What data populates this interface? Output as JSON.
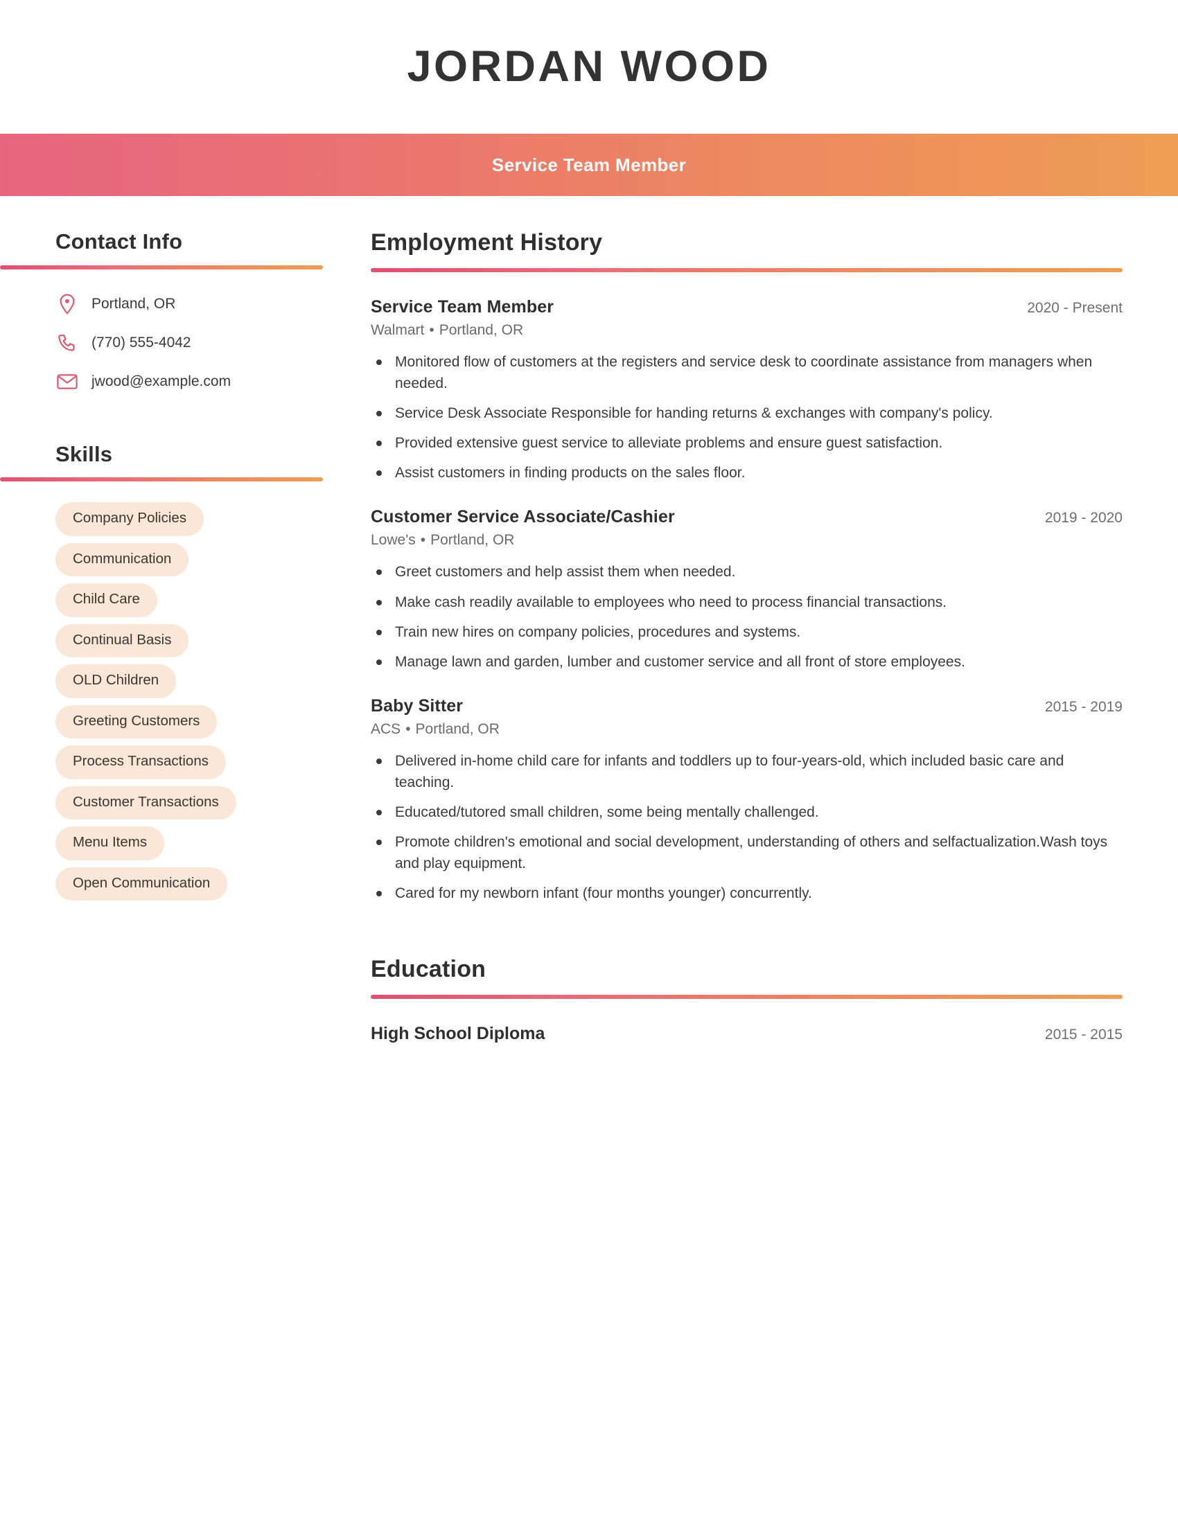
{
  "header": {
    "full_name": "JORDAN WOOD",
    "job_title": "Service Team Member",
    "accent_pink": "#e8657f",
    "accent_orange": "#ef9d54",
    "band_text_color": "#ffffff"
  },
  "sidebar": {
    "contact": {
      "heading": "Contact Info",
      "items": [
        {
          "icon": "location-pin-icon",
          "value": "Portland, OR"
        },
        {
          "icon": "phone-icon",
          "value": "(770) 555-4042"
        },
        {
          "icon": "envelope-icon",
          "value": "jwood@example.com"
        }
      ]
    },
    "skills": {
      "heading": "Skills",
      "chip_bg": "#fae7d7",
      "items": [
        "Company Policies",
        "Communication",
        "Child Care",
        "Continual Basis",
        "OLD Children",
        "Greeting Customers",
        "Process Transactions",
        "Customer Transactions",
        "Menu Items",
        "Open Communication"
      ]
    }
  },
  "main": {
    "employment": {
      "heading": "Employment History",
      "entries": [
        {
          "role": "Service Team Member",
          "dates": "2020 - Present",
          "company": "Walmart",
          "separator": "•",
          "location": "Portland, OR",
          "bullets": [
            "Monitored flow of customers at the registers and service desk to coordinate assistance from managers when needed.",
            "Service Desk Associate Responsible for handing returns & exchanges with company's policy.",
            "Provided extensive guest service to alleviate problems and ensure guest satisfaction.",
            "Assist customers in finding products on the sales floor."
          ]
        },
        {
          "role": "Customer Service Associate/Cashier",
          "dates": "2019 - 2020",
          "company": "Lowe's",
          "separator": "•",
          "location": "Portland, OR",
          "bullets": [
            "Greet customers and help assist them when needed.",
            "Make cash readily available to employees who need to process financial transactions.",
            "Train new hires on company policies, procedures and systems.",
            "Manage lawn and garden, lumber and customer service and all front of store employees."
          ]
        },
        {
          "role": "Baby Sitter",
          "dates": "2015 - 2019",
          "company": "ACS",
          "separator": "•",
          "location": "Portland, OR",
          "bullets": [
            "Delivered in-home child care for infants and toddlers up to four-years-old, which included basic care and teaching.",
            "Educated/tutored small children, some being mentally challenged.",
            "Promote children's emotional and social development, understanding of others and selfactualization.Wash toys and play equipment.",
            "Cared for my newborn infant (four months younger) concurrently."
          ]
        }
      ]
    },
    "education": {
      "heading": "Education",
      "entries": [
        {
          "degree": "High School Diploma",
          "dates": "2015 - 2015"
        }
      ]
    }
  }
}
